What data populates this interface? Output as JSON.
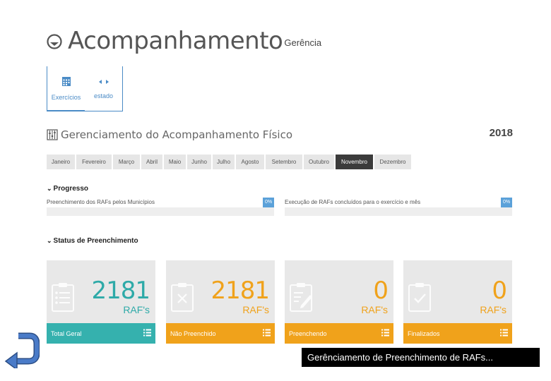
{
  "header": {
    "title": "Acompanhamento",
    "subtitle": "Gerência"
  },
  "topnav": [
    {
      "label": "Exercícios",
      "icon": "calendar-icon"
    },
    {
      "label": "estado",
      "icon": "arrows-horizontal-icon"
    }
  ],
  "section": {
    "title": "Gerenciamento do Acompanhamento Físico",
    "year": "2018"
  },
  "months": [
    "Janeiro",
    "Fevereiro",
    "Março",
    "Abril",
    "Maio",
    "Junho",
    "Julho",
    "Agosto",
    "Setembro",
    "Outubro",
    "Novembro",
    "Dezembro"
  ],
  "active_month": "Novembro",
  "progresso": {
    "title": "Progresso",
    "bars": [
      {
        "label": "Preenchimento dos RAFs pelos Municípios",
        "percent": "0%"
      },
      {
        "label": "Execução de RAFs concluídos para o exercício e mês",
        "percent": "0%"
      }
    ]
  },
  "status": {
    "title": "Status de Preenchimento",
    "cards": [
      {
        "value": "2181",
        "unit": "RAF's",
        "label": "Total Geral",
        "color": "#35b1ae",
        "icon": "clipboard-list-icon"
      },
      {
        "value": "2181",
        "unit": "RAF's",
        "label": "Não Preenchido",
        "color": "#f0a21b",
        "icon": "clipboard-x-icon"
      },
      {
        "value": "0",
        "unit": "RAF's",
        "label": "Preenchendo",
        "color": "#f0a21b",
        "icon": "clipboard-edit-icon"
      },
      {
        "value": "0",
        "unit": "RAF's",
        "label": "Finalizados",
        "color": "#f0a21b",
        "icon": "clipboard-check-icon"
      }
    ]
  },
  "caption": "Gerênciamento de Preenchimento de RAFs..."
}
